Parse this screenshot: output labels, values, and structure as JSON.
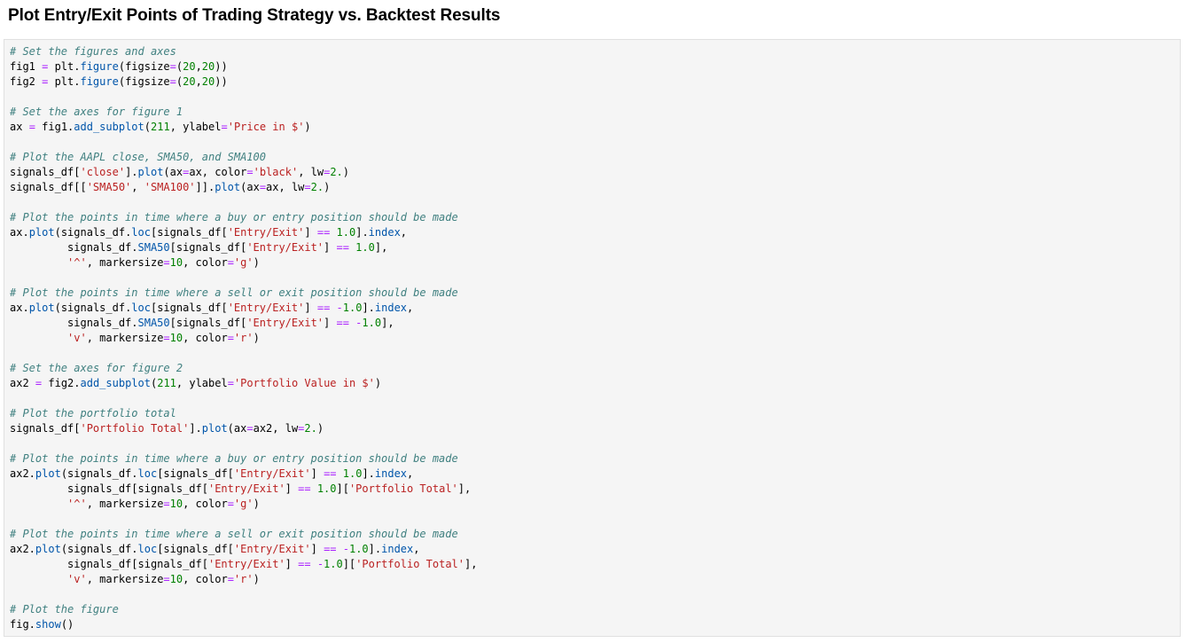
{
  "title": "Plot Entry/Exit Points of Trading Strategy vs. Backtest Results",
  "code_lines": [
    [
      {
        "t": "# Set the figures and axes",
        "k": "c"
      }
    ],
    [
      {
        "t": "fig1 "
      },
      {
        "t": "=",
        "k": "o"
      },
      {
        "t": " plt."
      },
      {
        "t": "figure",
        "k": "f"
      },
      {
        "t": "(figsize"
      },
      {
        "t": "=",
        "k": "o"
      },
      {
        "t": "("
      },
      {
        "t": "20",
        "k": "n"
      },
      {
        "t": ","
      },
      {
        "t": "20",
        "k": "n"
      },
      {
        "t": "))"
      }
    ],
    [
      {
        "t": "fig2 "
      },
      {
        "t": "=",
        "k": "o"
      },
      {
        "t": " plt."
      },
      {
        "t": "figure",
        "k": "f"
      },
      {
        "t": "(figsize"
      },
      {
        "t": "=",
        "k": "o"
      },
      {
        "t": "("
      },
      {
        "t": "20",
        "k": "n"
      },
      {
        "t": ","
      },
      {
        "t": "20",
        "k": "n"
      },
      {
        "t": "))"
      }
    ],
    [],
    [
      {
        "t": "# Set the axes for figure 1",
        "k": "c"
      }
    ],
    [
      {
        "t": "ax "
      },
      {
        "t": "=",
        "k": "o"
      },
      {
        "t": " fig1."
      },
      {
        "t": "add_subplot",
        "k": "f"
      },
      {
        "t": "("
      },
      {
        "t": "211",
        "k": "n"
      },
      {
        "t": ", ylabel"
      },
      {
        "t": "=",
        "k": "o"
      },
      {
        "t": "'Price in $'",
        "k": "s"
      },
      {
        "t": ")"
      }
    ],
    [],
    [
      {
        "t": "# Plot the AAPL close, SMA50, and SMA100",
        "k": "c"
      }
    ],
    [
      {
        "t": "signals_df["
      },
      {
        "t": "'close'",
        "k": "s"
      },
      {
        "t": "]."
      },
      {
        "t": "plot",
        "k": "f"
      },
      {
        "t": "(ax"
      },
      {
        "t": "=",
        "k": "o"
      },
      {
        "t": "ax, color"
      },
      {
        "t": "=",
        "k": "o"
      },
      {
        "t": "'black'",
        "k": "s"
      },
      {
        "t": ", lw"
      },
      {
        "t": "=",
        "k": "o"
      },
      {
        "t": "2.",
        "k": "n"
      },
      {
        "t": ")"
      }
    ],
    [
      {
        "t": "signals_df[["
      },
      {
        "t": "'SMA50'",
        "k": "s"
      },
      {
        "t": ", "
      },
      {
        "t": "'SMA100'",
        "k": "s"
      },
      {
        "t": "]]."
      },
      {
        "t": "plot",
        "k": "f"
      },
      {
        "t": "(ax"
      },
      {
        "t": "=",
        "k": "o"
      },
      {
        "t": "ax, lw"
      },
      {
        "t": "=",
        "k": "o"
      },
      {
        "t": "2.",
        "k": "n"
      },
      {
        "t": ")"
      }
    ],
    [],
    [
      {
        "t": "# Plot the points in time where a buy or entry position should be made",
        "k": "c"
      }
    ],
    [
      {
        "t": "ax."
      },
      {
        "t": "plot",
        "k": "f"
      },
      {
        "t": "(signals_df."
      },
      {
        "t": "loc",
        "k": "f"
      },
      {
        "t": "[signals_df["
      },
      {
        "t": "'Entry/Exit'",
        "k": "s"
      },
      {
        "t": "] "
      },
      {
        "t": "==",
        "k": "o"
      },
      {
        "t": " "
      },
      {
        "t": "1.0",
        "k": "n"
      },
      {
        "t": "]."
      },
      {
        "t": "index",
        "k": "f"
      },
      {
        "t": ","
      }
    ],
    [
      {
        "t": "         signals_df."
      },
      {
        "t": "SMA50",
        "k": "f"
      },
      {
        "t": "[signals_df["
      },
      {
        "t": "'Entry/Exit'",
        "k": "s"
      },
      {
        "t": "] "
      },
      {
        "t": "==",
        "k": "o"
      },
      {
        "t": " "
      },
      {
        "t": "1.0",
        "k": "n"
      },
      {
        "t": "],"
      }
    ],
    [
      {
        "t": "         "
      },
      {
        "t": "'^'",
        "k": "s"
      },
      {
        "t": ", markersize"
      },
      {
        "t": "=",
        "k": "o"
      },
      {
        "t": "10",
        "k": "n"
      },
      {
        "t": ", color"
      },
      {
        "t": "=",
        "k": "o"
      },
      {
        "t": "'g'",
        "k": "s"
      },
      {
        "t": ")"
      }
    ],
    [],
    [
      {
        "t": "# Plot the points in time where a sell or exit position should be made",
        "k": "c"
      }
    ],
    [
      {
        "t": "ax."
      },
      {
        "t": "plot",
        "k": "f"
      },
      {
        "t": "(signals_df."
      },
      {
        "t": "loc",
        "k": "f"
      },
      {
        "t": "[signals_df["
      },
      {
        "t": "'Entry/Exit'",
        "k": "s"
      },
      {
        "t": "] "
      },
      {
        "t": "==",
        "k": "o"
      },
      {
        "t": " "
      },
      {
        "t": "-",
        "k": "o"
      },
      {
        "t": "1.0",
        "k": "n"
      },
      {
        "t": "]."
      },
      {
        "t": "index",
        "k": "f"
      },
      {
        "t": ","
      }
    ],
    [
      {
        "t": "         signals_df."
      },
      {
        "t": "SMA50",
        "k": "f"
      },
      {
        "t": "[signals_df["
      },
      {
        "t": "'Entry/Exit'",
        "k": "s"
      },
      {
        "t": "] "
      },
      {
        "t": "==",
        "k": "o"
      },
      {
        "t": " "
      },
      {
        "t": "-",
        "k": "o"
      },
      {
        "t": "1.0",
        "k": "n"
      },
      {
        "t": "],"
      }
    ],
    [
      {
        "t": "         "
      },
      {
        "t": "'v'",
        "k": "s"
      },
      {
        "t": ", markersize"
      },
      {
        "t": "=",
        "k": "o"
      },
      {
        "t": "10",
        "k": "n"
      },
      {
        "t": ", color"
      },
      {
        "t": "=",
        "k": "o"
      },
      {
        "t": "'r'",
        "k": "s"
      },
      {
        "t": ")"
      }
    ],
    [],
    [
      {
        "t": "# Set the axes for figure 2",
        "k": "c"
      }
    ],
    [
      {
        "t": "ax2 "
      },
      {
        "t": "=",
        "k": "o"
      },
      {
        "t": " fig2."
      },
      {
        "t": "add_subplot",
        "k": "f"
      },
      {
        "t": "("
      },
      {
        "t": "211",
        "k": "n"
      },
      {
        "t": ", ylabel"
      },
      {
        "t": "=",
        "k": "o"
      },
      {
        "t": "'Portfolio Value in $'",
        "k": "s"
      },
      {
        "t": ")"
      }
    ],
    [],
    [
      {
        "t": "# Plot the portfolio total",
        "k": "c"
      }
    ],
    [
      {
        "t": "signals_df["
      },
      {
        "t": "'Portfolio Total'",
        "k": "s"
      },
      {
        "t": "]."
      },
      {
        "t": "plot",
        "k": "f"
      },
      {
        "t": "(ax"
      },
      {
        "t": "=",
        "k": "o"
      },
      {
        "t": "ax2, lw"
      },
      {
        "t": "=",
        "k": "o"
      },
      {
        "t": "2.",
        "k": "n"
      },
      {
        "t": ")"
      }
    ],
    [],
    [
      {
        "t": "# Plot the points in time where a buy or entry position should be made",
        "k": "c"
      }
    ],
    [
      {
        "t": "ax2."
      },
      {
        "t": "plot",
        "k": "f"
      },
      {
        "t": "(signals_df."
      },
      {
        "t": "loc",
        "k": "f"
      },
      {
        "t": "[signals_df["
      },
      {
        "t": "'Entry/Exit'",
        "k": "s"
      },
      {
        "t": "] "
      },
      {
        "t": "==",
        "k": "o"
      },
      {
        "t": " "
      },
      {
        "t": "1.0",
        "k": "n"
      },
      {
        "t": "]."
      },
      {
        "t": "index",
        "k": "f"
      },
      {
        "t": ","
      }
    ],
    [
      {
        "t": "         signals_df[signals_df["
      },
      {
        "t": "'Entry/Exit'",
        "k": "s"
      },
      {
        "t": "] "
      },
      {
        "t": "==",
        "k": "o"
      },
      {
        "t": " "
      },
      {
        "t": "1.0",
        "k": "n"
      },
      {
        "t": "]["
      },
      {
        "t": "'Portfolio Total'",
        "k": "s"
      },
      {
        "t": "],"
      }
    ],
    [
      {
        "t": "         "
      },
      {
        "t": "'^'",
        "k": "s"
      },
      {
        "t": ", markersize"
      },
      {
        "t": "=",
        "k": "o"
      },
      {
        "t": "10",
        "k": "n"
      },
      {
        "t": ", color"
      },
      {
        "t": "=",
        "k": "o"
      },
      {
        "t": "'g'",
        "k": "s"
      },
      {
        "t": ")"
      }
    ],
    [],
    [
      {
        "t": "# Plot the points in time where a sell or exit position should be made",
        "k": "c"
      }
    ],
    [
      {
        "t": "ax2."
      },
      {
        "t": "plot",
        "k": "f"
      },
      {
        "t": "(signals_df."
      },
      {
        "t": "loc",
        "k": "f"
      },
      {
        "t": "[signals_df["
      },
      {
        "t": "'Entry/Exit'",
        "k": "s"
      },
      {
        "t": "] "
      },
      {
        "t": "==",
        "k": "o"
      },
      {
        "t": " "
      },
      {
        "t": "-",
        "k": "o"
      },
      {
        "t": "1.0",
        "k": "n"
      },
      {
        "t": "]."
      },
      {
        "t": "index",
        "k": "f"
      },
      {
        "t": ","
      }
    ],
    [
      {
        "t": "         signals_df[signals_df["
      },
      {
        "t": "'Entry/Exit'",
        "k": "s"
      },
      {
        "t": "] "
      },
      {
        "t": "==",
        "k": "o"
      },
      {
        "t": " "
      },
      {
        "t": "-",
        "k": "o"
      },
      {
        "t": "1.0",
        "k": "n"
      },
      {
        "t": "]["
      },
      {
        "t": "'Portfolio Total'",
        "k": "s"
      },
      {
        "t": "],"
      }
    ],
    [
      {
        "t": "         "
      },
      {
        "t": "'v'",
        "k": "s"
      },
      {
        "t": ", markersize"
      },
      {
        "t": "=",
        "k": "o"
      },
      {
        "t": "10",
        "k": "n"
      },
      {
        "t": ", color"
      },
      {
        "t": "=",
        "k": "o"
      },
      {
        "t": "'r'",
        "k": "s"
      },
      {
        "t": ")"
      }
    ],
    [],
    [
      {
        "t": "# Plot the figure",
        "k": "c"
      }
    ],
    [
      {
        "t": "fig."
      },
      {
        "t": "show",
        "k": "f"
      },
      {
        "t": "()"
      }
    ]
  ]
}
